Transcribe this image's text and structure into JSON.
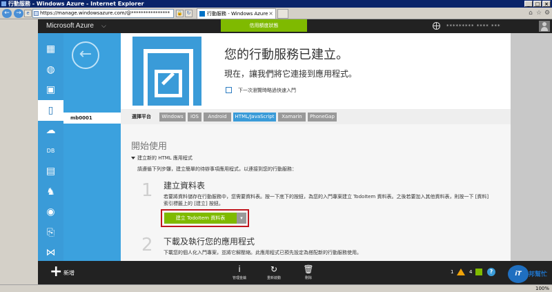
{
  "browser": {
    "title": "行動服務 - Windows Azure - Internet Explorer",
    "address": "https://manage.windowsazure.com/@****************",
    "tab_title": "行動服務 - Windows Azure",
    "zoom": "100%"
  },
  "azure": {
    "brand": "Microsoft Azure",
    "trial_badge": "信用額度狀態",
    "user": "********* **** ***"
  },
  "icon_nav": {
    "items": [
      {
        "name": "all-items-icon",
        "glyph": "▦"
      },
      {
        "name": "websites-icon",
        "glyph": "◍"
      },
      {
        "name": "virtual-machines-icon",
        "glyph": "▣"
      },
      {
        "name": "mobile-services-icon",
        "glyph": "▯"
      },
      {
        "name": "cloud-services-icon",
        "glyph": "☁"
      },
      {
        "name": "sql-databases-icon",
        "glyph": "DB"
      },
      {
        "name": "storage-icon",
        "glyph": "▤"
      },
      {
        "name": "hdinsight-icon",
        "glyph": "♞"
      },
      {
        "name": "media-services-icon",
        "glyph": "◉"
      },
      {
        "name": "service-bus-icon",
        "glyph": "⎘"
      },
      {
        "name": "visual-studio-icon",
        "glyph": "⋈"
      }
    ]
  },
  "subnav": {
    "item": "mb0001"
  },
  "hero": {
    "title": "您的行動服務已建立。",
    "subtitle": "現在，讓我們將它連接到應用程式。",
    "checkbox_label": "下一次瀏覽時略過快速入門"
  },
  "platform": {
    "label": "選擇平台",
    "tabs": [
      "Windows",
      "iOS",
      "Android",
      "HTML/JavaScript",
      "Xamarin",
      "PhoneGap"
    ],
    "active": "HTML/JavaScript"
  },
  "getting_started": {
    "title": "開始使用",
    "section_head": "建立新的 HTML 應用程式",
    "section_desc": "請遵循下列步驟，建立簡單的待辦事項應用程式，以連接到您的行動服務：",
    "steps": [
      {
        "number": "1",
        "title": "建立資料表",
        "body": "若要將資料儲存在行動服務中，您需要資料表。按一下底下的按鈕，為您的入門專案建立 TodoItem 資料表。之後若要加入其他資料表，則按一下 [資料] 索引標籤上的 [建立] 按鈕。",
        "button": "建立 TodoItem 資料表"
      },
      {
        "number": "2",
        "title": "下載及執行您的應用程式",
        "body": "下載您的個人化入門專案，並將它解壓縮。此應用程式已預先設定為搭配新的行動服務使用。"
      }
    ]
  },
  "command_bar": {
    "new_label": "新增",
    "commands": [
      {
        "glyph": "i",
        "label": "管理金鑰"
      },
      {
        "glyph": "↻",
        "label": "重新啟動"
      },
      {
        "glyph": "🗑",
        "label": "刪除"
      }
    ],
    "warning_count": "1",
    "running_count": "4"
  },
  "watermark": {
    "logo": "iT",
    "text": "邦幫忙"
  },
  "colors": {
    "azure_blue": "#3a9bd8",
    "green": "#7fba00",
    "header_dark": "#222222",
    "highlight_red": "#c0141c"
  }
}
